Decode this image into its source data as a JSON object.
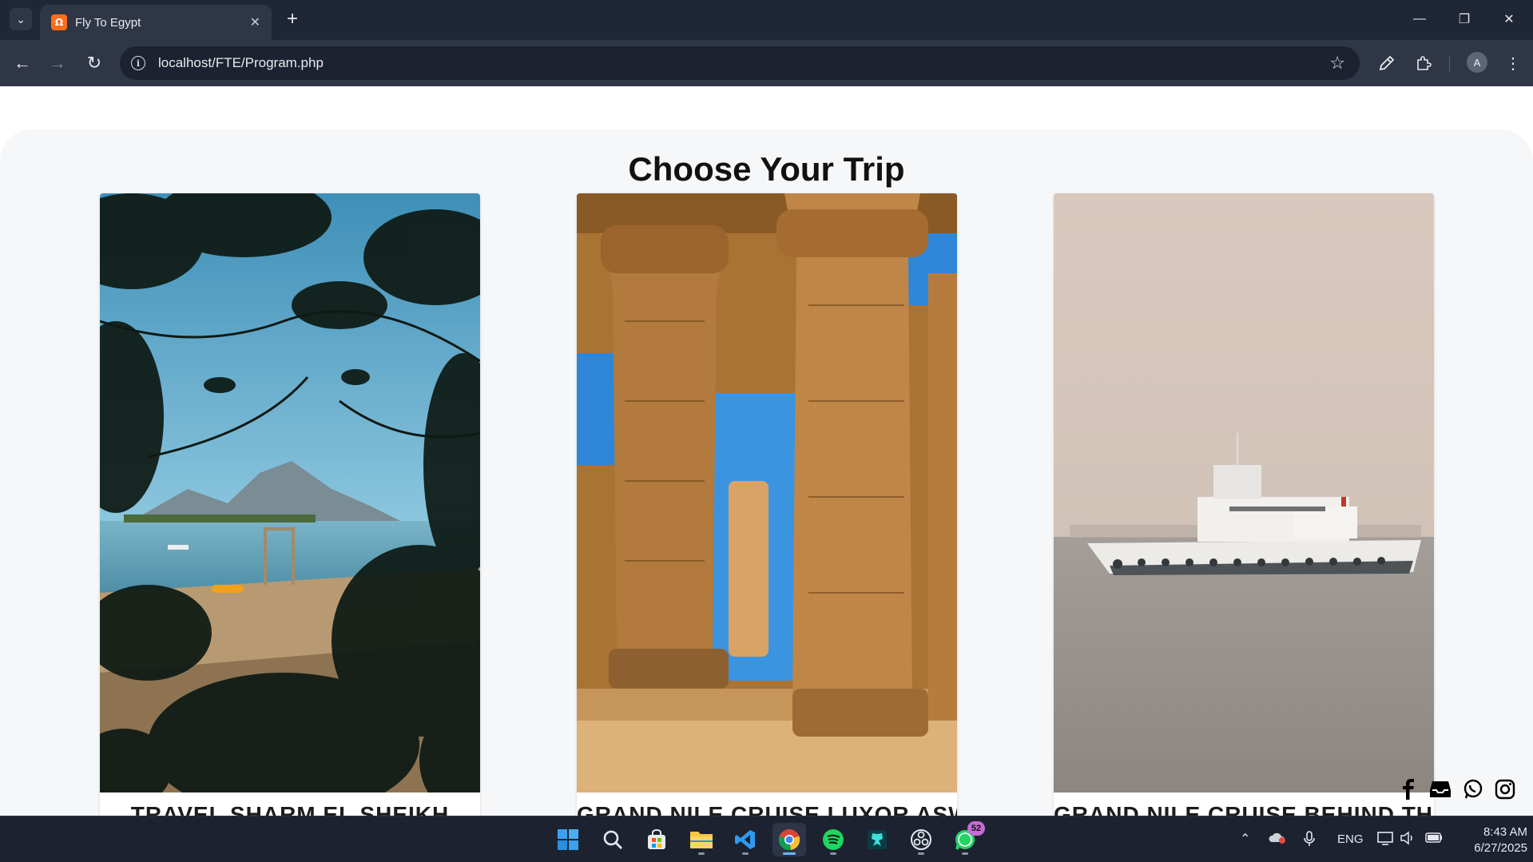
{
  "browser": {
    "tab_title": "Fly To Egypt",
    "favicon_letter": "Ω",
    "url": "localhost/FTE/Program.php",
    "profile_initial": "A"
  },
  "page": {
    "title": "Choose Your Trip",
    "cards": [
      {
        "title": "TRAVEL SHARM EL SHEIKH",
        "image": "beach-bay-through-leaves"
      },
      {
        "title": "GRAND NILE CRUISE LUXOR ASWAN",
        "image": "temple-columns"
      },
      {
        "title": "GRAND NILE CRUISE BEHIND THE",
        "image": "ship-on-sea"
      }
    ],
    "social_icons": [
      "facebook-icon",
      "inbox-icon",
      "whatsapp-icon",
      "instagram-icon"
    ]
  },
  "taskbar": {
    "apps": [
      "windows-start",
      "search",
      "microsoft-store",
      "file-explorer",
      "vs-code",
      "chrome",
      "spotify",
      "app-icon",
      "obs",
      "whatsapp"
    ],
    "whatsapp_badge": "52",
    "language": "ENG",
    "time": "8:43 AM",
    "date": "6/27/2025"
  },
  "colors": {
    "chrome_dark": "#1f2635",
    "chrome_toolbar": "#2f3646",
    "page_section_bg": "#f6f7f9",
    "taskbar": "#1c2230"
  }
}
